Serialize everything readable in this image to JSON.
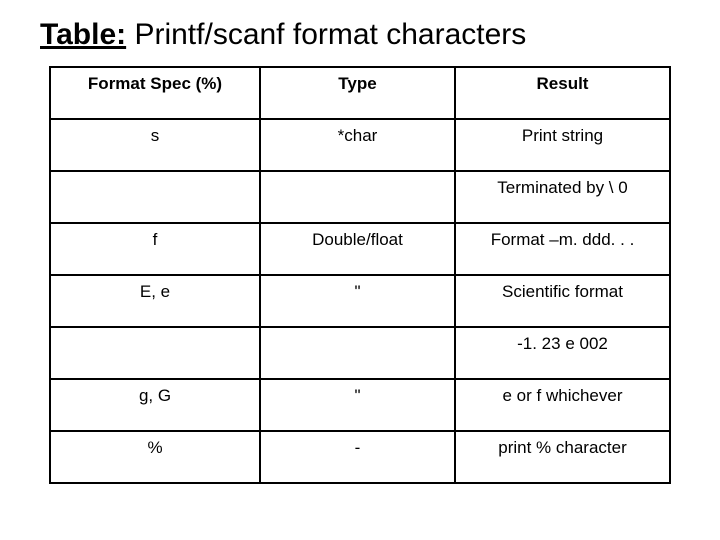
{
  "title_prefix": "Table:",
  "title_rest": " Printf/scanf format characters",
  "headers": [
    "Format Spec (%)",
    "Type",
    "Result"
  ],
  "rows": [
    [
      "s",
      "*char",
      "Print string"
    ],
    [
      "",
      "",
      "Terminated by \\ 0"
    ],
    [
      "f",
      "Double/float",
      "Format –m. ddd. . ."
    ],
    [
      "E, e",
      "\"",
      "Scientific format"
    ],
    [
      "",
      "",
      "-1. 23 e 002"
    ],
    [
      "g, G",
      "\"",
      "e or f whichever"
    ],
    [
      "%",
      "-",
      "print % character"
    ]
  ]
}
